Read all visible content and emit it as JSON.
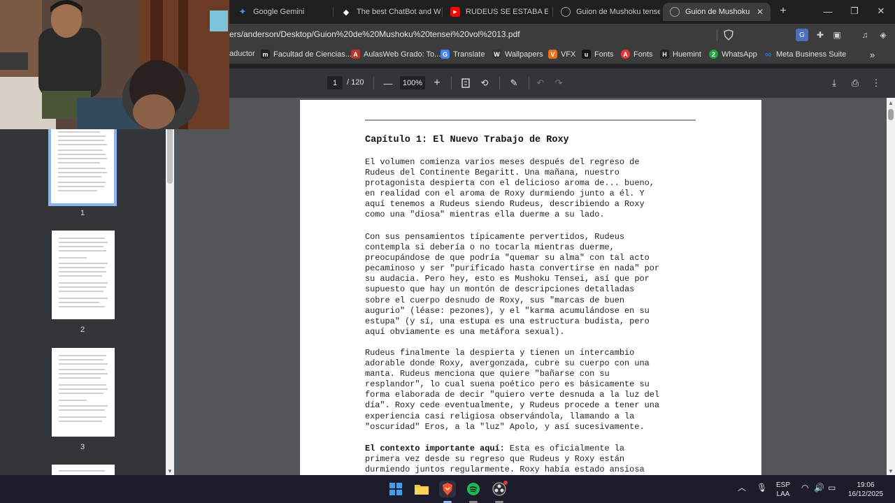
{
  "tabs": [
    {
      "title": "Google Gemini",
      "icon": "gemini-icon",
      "color": "#4f8df5"
    },
    {
      "title": "The best ChatBot and Wid",
      "icon": "chatbot-icon",
      "color": "#ffffff"
    },
    {
      "title": "RUDEUS SE ESTABA EN",
      "icon": "youtube-icon",
      "color": "#ff0000"
    },
    {
      "title": "Guion de Mushoku tensei",
      "icon": "globe-icon",
      "color": "#9aa0a6"
    },
    {
      "title": "Guion de Mushoku te",
      "icon": "globe-icon",
      "color": "#9aa0a6"
    }
  ],
  "address": {
    "url": "ers/anderson/Desktop/Guion%20de%20Mushoku%20tensei%20vol%2013.pdf"
  },
  "bookmarks": [
    {
      "label": "aductor",
      "icon": "",
      "color": "#3c3c3c"
    },
    {
      "label": "Facultad de Ciencias...",
      "icon": "m",
      "color": "#222222"
    },
    {
      "label": "AulasWeb Grado: To...",
      "icon": "A",
      "color": "#b8362f"
    },
    {
      "label": "Translate",
      "icon": "G",
      "color": "#4285f4"
    },
    {
      "label": "Wallpapers",
      "icon": "W",
      "color": "#333333"
    },
    {
      "label": "VFX",
      "icon": "V",
      "color": "#e8711c"
    },
    {
      "label": "Fonts",
      "icon": "u",
      "color": "#111111"
    },
    {
      "label": "Fonts",
      "icon": "A",
      "color": "#e53935"
    },
    {
      "label": "Huemint",
      "icon": "H",
      "color": "#222222"
    },
    {
      "label": "WhatsApp",
      "icon": "2",
      "color": "#25a244"
    },
    {
      "label": "Meta Business Suite",
      "icon": "∞",
      "color": "#1877f2"
    }
  ],
  "pdf_toolbar": {
    "page": "1",
    "total": "/ 120",
    "zoom": "100%"
  },
  "thumbnails": [
    {
      "label": "1",
      "selected": true
    },
    {
      "label": "2",
      "selected": false
    },
    {
      "label": "3",
      "selected": false
    }
  ],
  "document": {
    "chapter_title": "Capítulo 1: El Nuevo Trabajo de Roxy",
    "paragraph1": "El volumen comienza varios meses después del regreso de\nRudeus del Continente Begaritt. Una mañana, nuestro\nprotagonista despierta con el delicioso aroma de... bueno,\nen realidad con el aroma de Roxy durmiendo junto a él. Y\naquí tenemos a Rudeus siendo Rudeus, describiendo a Roxy\ncomo una \"diosa\" mientras ella duerme a su lado.",
    "paragraph2": "Con sus pensamientos típicamente pervertidos, Rudeus\ncontempla si debería o no tocarla mientras duerme,\npreocupándose de que podría \"quemar su alma\" con tal acto\npecaminoso y ser \"purificado hasta convertirse en nada\" por\nsu audacia. Pero hey, esto es Mushoku Tensei, así que por\nsupuesto que hay un montón de descripciones detalladas\nsobre el cuerpo desnudo de Roxy, sus \"marcas de buen\naugurio\" (léase: pezones), y el \"karma acumulándose en su\nestupa\" (y sí, una estupa es una estructura budista, pero\naquí obviamente es una metáfora sexual).",
    "paragraph3": "Rudeus finalmente la despierta y tienen un intercambio\nadorable donde Roxy, avergonzada, cubre su cuerpo con una\nmanta. Rudeus menciona que quiere \"bañarse con su\nresplandor\", lo cual suena poético pero es básicamente su\nforma elaborada de decir \"quiero verte desnuda a la luz del\ndía\". Roxy cede eventualmente, y Rudeus procede a tener una\nexperiencia casi religiosa observándola, llamando a la\n\"oscuridad\" Eros, a la \"luz\" Apolo, y así sucesivamente.",
    "paragraph4_bold": "El contexto importante aquí:",
    "paragraph4_rest": " Esta es oficialmente la\nprimera vez desde su regreso que Rudeus y Roxy están\ndurmiendo juntos regularmente. Roxy había estado ansiosa"
  },
  "tray": {
    "lang_top": "ESP",
    "lang_bottom": "LAA",
    "time": "19:06",
    "date": "16/12/2025"
  }
}
